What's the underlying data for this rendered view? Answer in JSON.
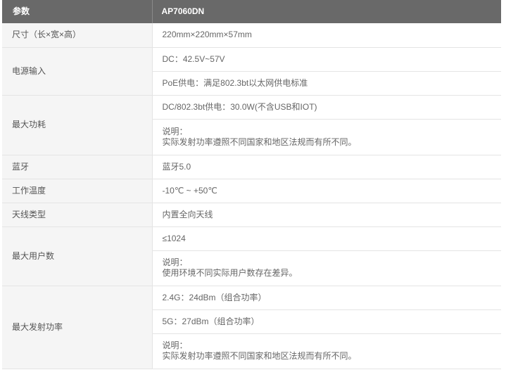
{
  "header": {
    "param": "参数",
    "model": "AP7060DN"
  },
  "rows": {
    "size": {
      "label": "尺寸（长×宽×高）",
      "value": "220mm×220mm×57mm"
    },
    "power_input": {
      "label": "电源输入",
      "values": [
        "DC：42.5V~57V",
        "PoE供电：满足802.3bt以太网供电标准"
      ]
    },
    "max_power": {
      "label": "最大功耗",
      "value": "DC/802.3bt供电：30.0W(不含USB和IOT)",
      "note_title": "说明：",
      "note_text": "实际发射功率遵照不同国家和地区法规而有所不同。"
    },
    "bluetooth": {
      "label": "蓝牙",
      "value": "蓝牙5.0"
    },
    "temperature": {
      "label": "工作温度",
      "value": "-10℃ ~ +50℃"
    },
    "antenna": {
      "label": "天线类型",
      "value": "内置全向天线"
    },
    "max_users": {
      "label": "最大用户数",
      "value": "≤1024",
      "note_title": "说明：",
      "note_text": "使用环境不同实际用户数存在差异。"
    },
    "max_tx_power": {
      "label": "最大发射功率",
      "values": [
        "2.4G：24dBm（组合功率）",
        "5G：27dBm（组合功率）"
      ],
      "note_title": "说明：",
      "note_text": "实际发射功率遵照不同国家和地区法规而有所不同。"
    }
  }
}
